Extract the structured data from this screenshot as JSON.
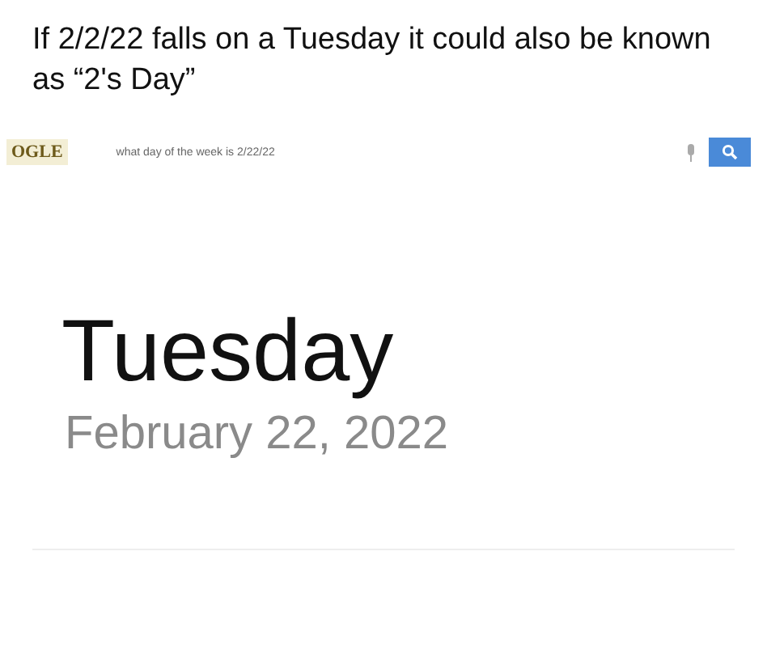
{
  "caption": "If 2/2/22 falls on a Tuesday it could also be known as “2's Day”",
  "search": {
    "logo": "OGLE",
    "value": "what day of the week is 2/22/22"
  },
  "result": {
    "day": "Tuesday",
    "date": "February 22, 2022"
  }
}
